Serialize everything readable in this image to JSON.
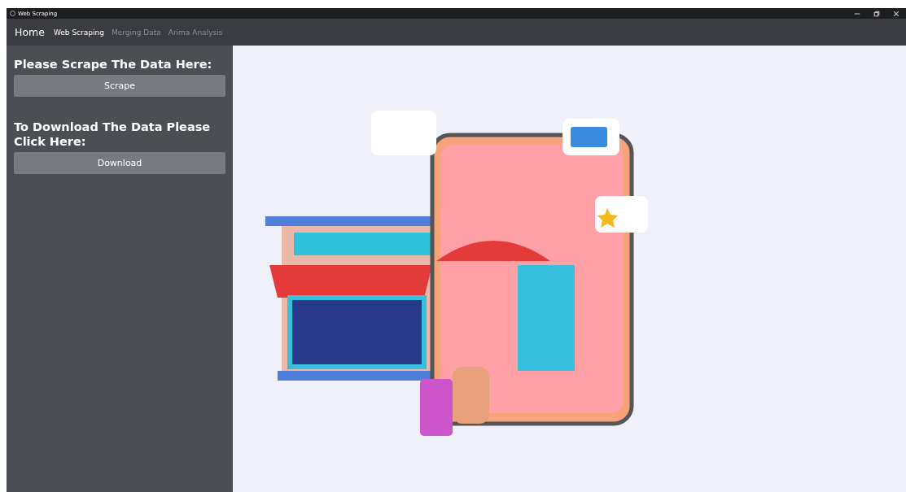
{
  "window": {
    "title": "Web Scraping",
    "controls": [
      {
        "kind": "minimize"
      },
      {
        "kind": "restore"
      },
      {
        "kind": "close"
      }
    ]
  },
  "navbar": {
    "brand": "Home",
    "tabs": [
      {
        "label": "Web Scraping",
        "selected": true
      },
      {
        "label": "Merging Data",
        "selected": false
      },
      {
        "label": "Arima Analysis",
        "selected": false
      }
    ]
  },
  "sidebar": {
    "sections": [
      {
        "heading": "Please Scrape The Data Here:",
        "button": "Scrape"
      },
      {
        "heading": "To Download The Data Please Click Here:",
        "button": "Download"
      }
    ]
  }
}
